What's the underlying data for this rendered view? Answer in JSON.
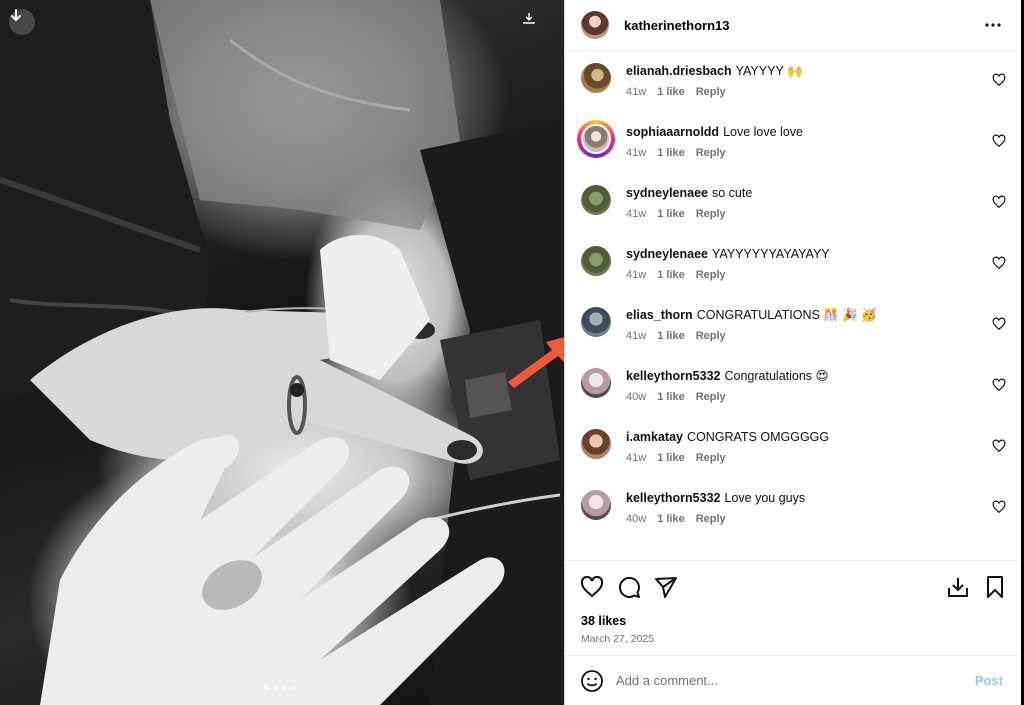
{
  "post": {
    "author": "katherinethorn13",
    "author_avatar_icon": "user-avatar",
    "more_icon": "more-horizontal-icon",
    "likes_text": "38 likes",
    "date": "March 27, 2025",
    "carousel": {
      "slides": 4,
      "active_index": 0
    }
  },
  "comments": [
    {
      "user": "elianah.driesbach",
      "text": "YAYYYY 🙌",
      "age": "41w",
      "likes": "1 like",
      "reply": "Reply"
    },
    {
      "user": "sophiaaarnoldd",
      "text": "Love love love",
      "age": "41w",
      "likes": "1 like",
      "reply": "Reply"
    },
    {
      "user": "sydneylenaee",
      "text": "so cute",
      "age": "41w",
      "likes": "1 like",
      "reply": "Reply"
    },
    {
      "user": "sydneylenaee",
      "text": "YAYYYYYYAYAYAYY",
      "age": "41w",
      "likes": "1 like",
      "reply": "Reply"
    },
    {
      "user": "elias_thorn",
      "text": "CONGRATULATIONS 🎊 🎉 🥳",
      "age": "41w",
      "likes": "1 like",
      "reply": "Reply"
    },
    {
      "user": "kelleythorn5332",
      "text": "Congratulations 😍",
      "age": "40w",
      "likes": "1 like",
      "reply": "Reply"
    },
    {
      "user": "i.amkatay",
      "text": "CONGRATS OMGGGGG",
      "age": "41w",
      "likes": "1 like",
      "reply": "Reply"
    },
    {
      "user": "kelleythorn5332",
      "text": "Love you guys",
      "age": "40w",
      "likes": "1 like",
      "reply": "Reply"
    }
  ],
  "composer": {
    "placeholder": "Add a comment...",
    "post_label": "Post"
  },
  "colors": {
    "annotation_arrow": "#ee5a3c",
    "post_button": "#9bc4f5",
    "story_ring": "#ee2a7b"
  }
}
